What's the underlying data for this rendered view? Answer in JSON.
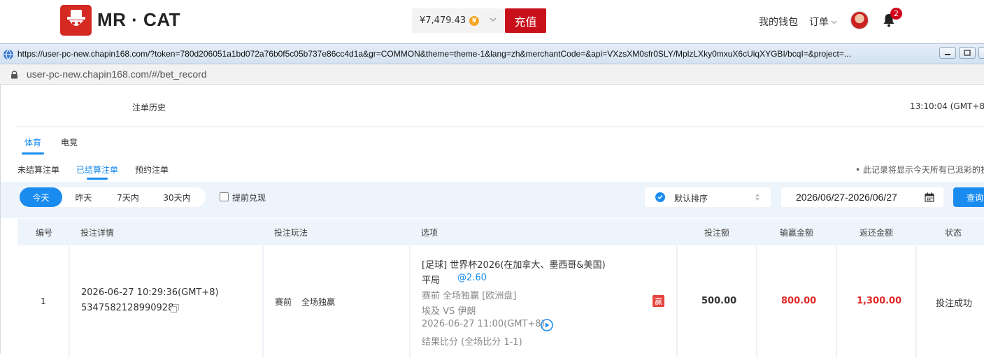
{
  "header": {
    "brand": "MR · CAT",
    "balance": "¥7,479.43",
    "deposit_label": "充值",
    "wallet_label": "我的钱包",
    "orders_label": "订单",
    "notification_count": "2",
    "brand_color": "#c8101b"
  },
  "popup": {
    "window_url": "https://user-pc-new.chapin168.com/?token=780d206051a1bd072a76b0f5c05b737e86cc4d1a&gr=COMMON&theme=theme-1&lang=zh&merchantCode=&api=VXzsXM0sfr0SLY/MplzLXky0mxuX6cUiqXYGBI/bcqI=&project=...",
    "address": "user-pc-new.chapin168.com/#/bet_record"
  },
  "page": {
    "title": "注单历史",
    "server_time": "13:10:04 (GMT+8)",
    "tabs": [
      "体育",
      "电竞"
    ],
    "subtabs": [
      "未结算注单",
      "已结算注单",
      "预约注单"
    ],
    "notice": "• 此记录将显示今天所有已派彩的投",
    "accent_color": "#1a8cf0"
  },
  "filters": {
    "date_options": [
      "今天",
      "昨天",
      "7天内",
      "30天内"
    ],
    "early_cashout_label": "提前兑现",
    "sort_label": "默认排序",
    "date_range": "2026/06/27-2026/06/27",
    "query_label": "查询"
  },
  "table": {
    "columns": [
      "编号",
      "投注详情",
      "投注玩法",
      "选项",
      "投注额",
      "输赢金额",
      "返还金额",
      "状态"
    ],
    "rows": [
      {
        "index": "1",
        "bet_time": "2026-06-27 10:29:36(GMT+8)",
        "bet_id": "5347582128990928",
        "play_type": "赛前",
        "play_market": "全场独赢",
        "league": "[足球] 世界杯2026(在加拿大、墨西哥&美国)",
        "selection": "平局",
        "odds": "@2.60",
        "market_line": "赛前 全场独赢 [欧洲盘]",
        "teams": "埃及 VS 伊朗",
        "match_time": "2026-06-27 11:00(GMT+8)",
        "result": "结果比分 (全场比分 1-1)",
        "win_tag": "赢",
        "stake": "500.00",
        "win_loss": "800.00",
        "payout": "1,300.00",
        "status": "投注成功"
      }
    ]
  }
}
